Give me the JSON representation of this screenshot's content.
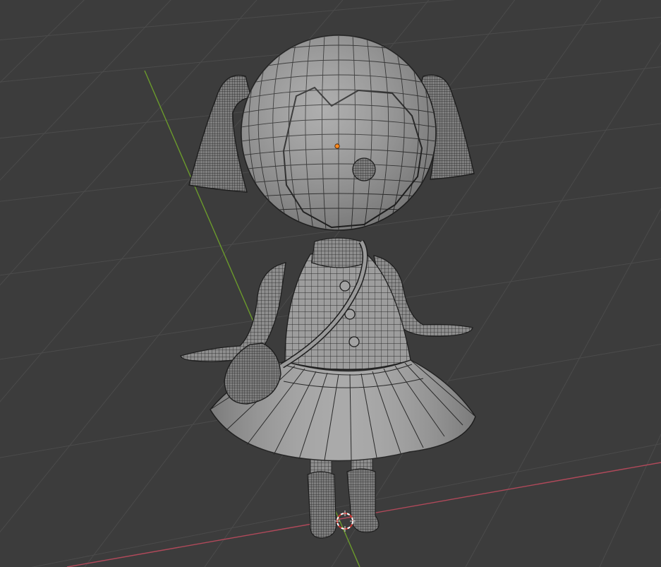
{
  "viewport": {
    "background_color": "#3c3c3c",
    "grid_color": "#4a4a4a",
    "x_axis_color": "#b34f5c",
    "y_axis_color": "#6f9a2e",
    "mesh_fill": "#9c9c9c",
    "wire_color": "#262626",
    "origin_color": "#ff8a1f"
  },
  "scene": {
    "object": "character-mesh",
    "mode": "wireframe-overlay",
    "icons": [
      "3d-cursor-icon",
      "object-origin-icon"
    ]
  }
}
